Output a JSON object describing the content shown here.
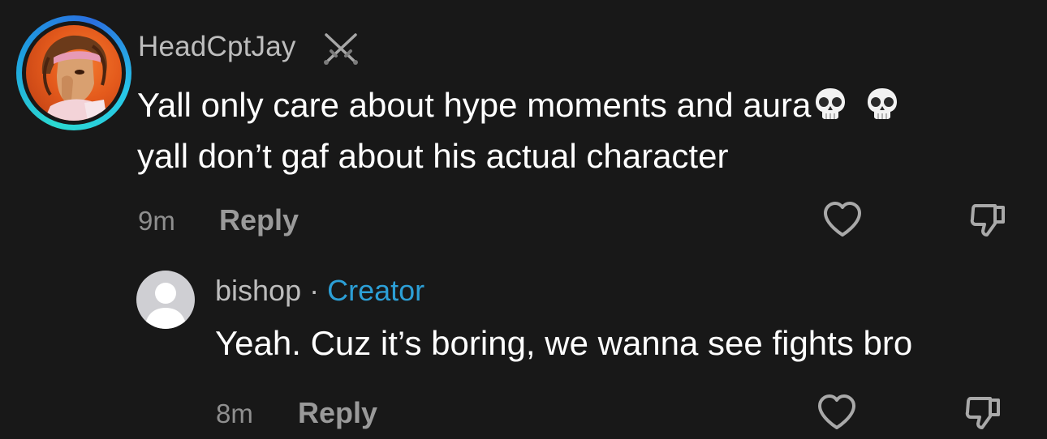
{
  "comment": {
    "username": "HeadCptJay",
    "username_icon": "crossed-swords-icon",
    "text_line1": "Yall only care about hype moments and aura",
    "emoji": "skull-icon",
    "text_line2": "yall don’t gaf about his actual character",
    "time": "9m",
    "reply_label": "Reply"
  },
  "reply": {
    "username": "bishop",
    "separator": "·",
    "badge": "Creator",
    "text": "Yeah. Cuz it’s boring, we wanna see fights bro",
    "time": "8m",
    "reply_label": "Reply"
  },
  "colors": {
    "background": "#181818",
    "creator_badge": "#2c9fd6",
    "avatar_ring": "#1e9ee0"
  },
  "icons": {
    "like": "heart-outline-icon",
    "dislike": "thumbs-down-outline-icon"
  }
}
